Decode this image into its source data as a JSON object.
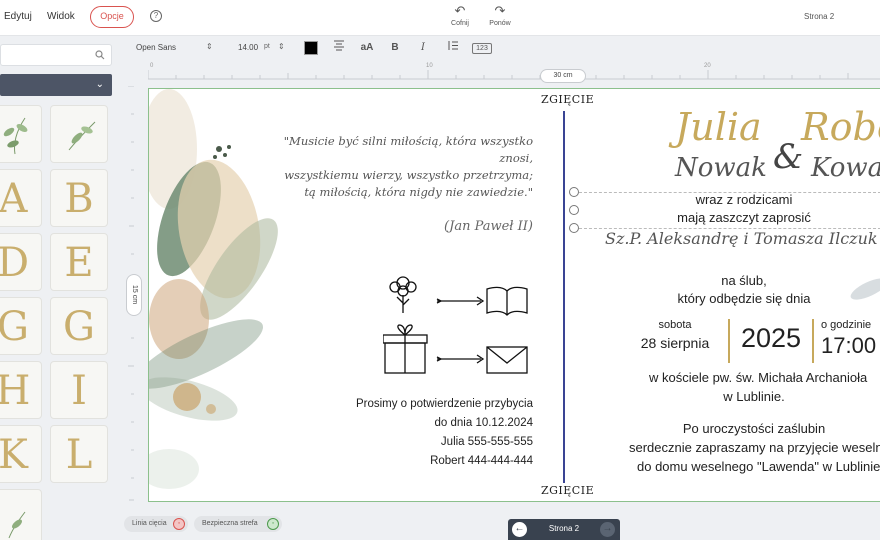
{
  "menu": {
    "edit": "Edytuj",
    "view": "Widok",
    "options": "Opcje",
    "help_icon": "?"
  },
  "history": {
    "undo": "Cofnij",
    "redo": "Ponów"
  },
  "page_indicator": "Strona 2",
  "toolbar": {
    "font": "Open Sans",
    "size": "14.00",
    "unit": "pt",
    "color": "#000000",
    "bold": "B",
    "italic": "I",
    "case": "aA",
    "numbers": "123"
  },
  "ruler": {
    "ticks": [
      "0",
      "10",
      "20"
    ],
    "width_label": "30 cm",
    "height_label": "15 cm"
  },
  "left_panel": {
    "search_placeholder": "",
    "tiles": [
      "",
      "",
      "A",
      "B",
      "D",
      "E",
      "G",
      "G",
      "H",
      "I",
      "K",
      "L",
      ""
    ]
  },
  "card": {
    "fold_label": "ZGIĘCIE",
    "quote": [
      "\"Musicie być silni miłością, która wszystko znosi,",
      "wszystkiemu wierzy, wszystko przetrzyma;",
      "tą miłością, która nigdy nie zawiedzie.\""
    ],
    "quote_author": "(Jan Paweł II)",
    "rsvp": [
      "Prosimy o potwierdzenie przybycia",
      "do dnia 10.12.2024",
      "Julia 555-555-555",
      "Robert 444-444-444"
    ],
    "bride_first": "Julia",
    "bride_last": "Nowak",
    "ampersand": "&",
    "groom_first": "Robert",
    "groom_last": "Kowalski",
    "invite": [
      "wraz z rodzicami",
      "mają zaszczyt zaprosić"
    ],
    "parents": "Sz.P. Aleksandrę i Tomasza Ilczuk",
    "event": [
      "na ślub,",
      "który odbędzie się dnia"
    ],
    "day": "sobota",
    "date": "28 sierpnia",
    "year": "2025",
    "time_label": "o godzinie",
    "time": "17:00",
    "church": [
      "w kościele pw. św. Michała Archanioła",
      "w Lublinie."
    ],
    "reception": [
      "Po uroczystości zaślubin",
      "serdecznie zapraszamy na przyjęcie weselne",
      "do domu weselnego \"Lawenda\" w Lublinie"
    ]
  },
  "bottom": {
    "cut_line": "Linia cięcia",
    "safe_zone": "Bezpieczna strefa",
    "page_nav": "Strona 2"
  },
  "colors": {
    "accent_red": "#d9534f",
    "gold": "#c7a95c",
    "fold_line": "#3a4494",
    "nav_bg": "#39424f"
  }
}
